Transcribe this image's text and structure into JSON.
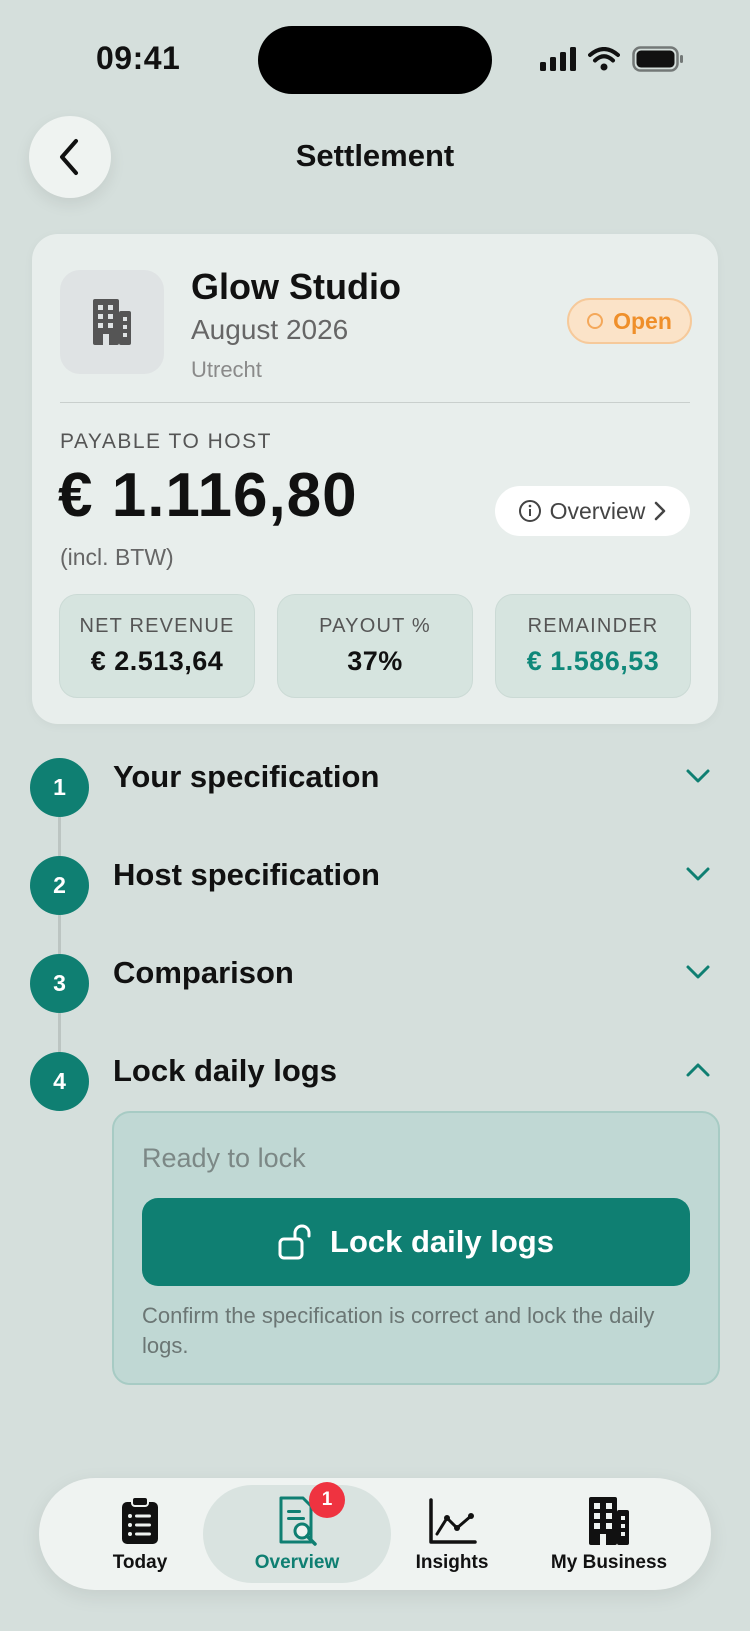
{
  "status_bar": {
    "time": "09:41"
  },
  "header": {
    "title": "Settlement"
  },
  "business": {
    "name": "Glow Studio",
    "period": "August 2026",
    "city": "Utrecht",
    "status": "Open"
  },
  "payable": {
    "label": "PAYABLE TO HOST",
    "amount": "€ 1.116,80",
    "note": "(incl. BTW)",
    "overview_label": "Overview"
  },
  "stats": [
    {
      "label": "NET REVENUE",
      "value": "€ 2.513,64"
    },
    {
      "label": "PAYOUT %",
      "value": "37%"
    },
    {
      "label": "REMAINDER",
      "value": "€ 1.586,53"
    }
  ],
  "steps": [
    {
      "number": "1",
      "title": "Your specification",
      "expanded": false
    },
    {
      "number": "2",
      "title": "Host specification",
      "expanded": false
    },
    {
      "number": "3",
      "title": "Comparison",
      "expanded": false
    },
    {
      "number": "4",
      "title": "Lock daily logs",
      "expanded": true
    }
  ],
  "lock_panel": {
    "status": "Ready to lock",
    "button_label": "Lock daily logs",
    "description": "Confirm the specification is correct and lock the daily logs."
  },
  "tabs": [
    {
      "label": "Today",
      "icon": "clipboard-list-icon"
    },
    {
      "label": "Overview",
      "icon": "document-search-icon",
      "badge": "1",
      "active": true
    },
    {
      "label": "Insights",
      "icon": "line-chart-icon"
    },
    {
      "label": "My Business",
      "icon": "building-icon"
    }
  ],
  "colors": {
    "accent": "#0f7f72",
    "status_open": "#ef8f2a",
    "badge": "#ef3340"
  }
}
